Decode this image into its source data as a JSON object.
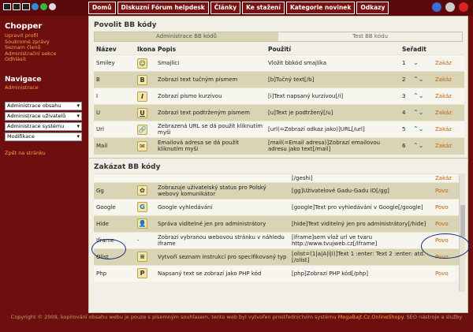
{
  "nav": {
    "tabs": [
      "Domů",
      "Diskuzní Fórum helpdesk",
      "Články",
      "Ke stažení",
      "Kategorie novinek",
      "Odkazy"
    ]
  },
  "sidebar": {
    "title": "Chopper",
    "links": [
      "Upravit profil",
      "Soukromé zprávy",
      "Seznam členů",
      "Administrační sekce",
      "Odhlásit"
    ],
    "nav_title": "Navigace",
    "nav_current": "Administrace",
    "selects": [
      "Administrace obsahu",
      "Administrace uživatelů",
      "Administrace systému",
      "Modifikace"
    ],
    "back": "Zpět na stránku"
  },
  "enable": {
    "title": "Povolit BB kódy",
    "subtabs": [
      "Administrace BB kódů",
      "Test BB kódu"
    ],
    "headers": [
      "Název",
      "Ikona",
      "Popis",
      "Použití",
      "Seřadit"
    ],
    "rows": [
      {
        "name": "Smiley",
        "icon": "☺",
        "desc": "Smajlíci",
        "usage": "Vložit bbkód smajlíka",
        "order": "1",
        "action": "Zakáz"
      },
      {
        "name": "B",
        "icon": "B",
        "desc": "Zobrazí text tučným písmem",
        "usage": "[b]Tučný text[/b]",
        "order": "2",
        "action": "Zakáz"
      },
      {
        "name": "I",
        "icon": "I",
        "desc": "Zobrazí písmo kurzívou",
        "usage": "[i]Text napsaný kurzívou[/i]",
        "order": "3",
        "action": "Zakáz"
      },
      {
        "name": "U",
        "icon": "U",
        "desc": "Zobrazí text podtrženým písmem",
        "usage": "[u]Text je podtržený[/u]",
        "order": "4",
        "action": "Zakáz"
      },
      {
        "name": "Url",
        "icon": "🔗",
        "desc": "Zebrazená URL se dá použít kliknutím myši",
        "usage": "[url(=Zobrazí odkaz jako)]URL[/url]",
        "order": "5",
        "action": "Zakáz"
      },
      {
        "name": "Mail",
        "icon": "✉",
        "desc": "Emailová adresa se dá použít kliknutím myši",
        "usage": "[mail(=Email adresa)]Zobrazí emailovou adresu jako text[/mail]",
        "order": "6",
        "action": "Zakáz"
      }
    ]
  },
  "disable": {
    "title": "Zakázat BB kódy",
    "rows": [
      {
        "name": "",
        "icon": "",
        "desc": "",
        "usage": "[/geshi]",
        "action": "Zakáz"
      },
      {
        "name": "Gg",
        "icon": "✿",
        "desc": "Zobrazuje uživatelský status pro Polský webový komunikátor",
        "usage": "[gg]Uživatelové Gadu-Gadu ID[/gg]",
        "action": "Povo"
      },
      {
        "name": "Google",
        "icon": "G",
        "desc": "Google vyhledávání",
        "usage": "[google]Text pro vyhledávání v Google[/google]",
        "action": "Povo"
      },
      {
        "name": "Hide",
        "icon": "👤",
        "desc": "Správa viditelné jen pro administrátory",
        "usage": "[hide]Text viditelný jen pro administrátory[/hide]",
        "action": "Povo"
      },
      {
        "name": "Iframe",
        "icon": "-",
        "desc": "Zobrazí vybranou webovou stránku v náhledu iframe",
        "usage": "[iframe]sem vlož url ve tvaru http://www.tvujweb.cz[/iframe]",
        "action": "Povo"
      },
      {
        "name": "Olist",
        "icon": "≡",
        "desc": "Vytvoří seznam instrukcí pro specifikovaný typ",
        "usage": "[olist=(1|a|A|i|I)]Text 1 :enter: Text 2 :enter: atd.[/olist]",
        "action": "Povo"
      },
      {
        "name": "Php",
        "icon": "P",
        "desc": "Napsaný text se zobrazí jako PHP kód",
        "usage": "[php]Zobrazí PHP kód[/php]",
        "action": "Povo"
      }
    ]
  },
  "footer": {
    "text": "Copyright © 2009, kopírování obsahu webu je pouze s písemným souhlasem, tento web byl vytvořen prostřednictvím systému",
    "brand": "MegaBajt.Cz.OnlineShopy",
    "text2": ". SEO nástroje a služby"
  }
}
